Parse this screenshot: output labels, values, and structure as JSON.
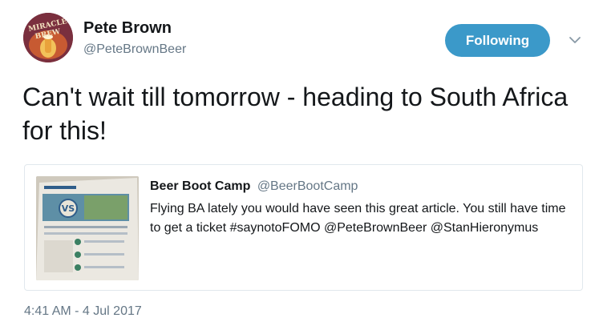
{
  "author": {
    "display_name": "Pete Brown",
    "handle": "@PeteBrownBeer",
    "avatar_icon": "miracle-brew-book-cover-icon",
    "avatar_text": "MIRACLE BREW"
  },
  "follow_button": {
    "label": "Following",
    "color": "#3b99c9"
  },
  "menu": {
    "icon": "chevron-down-icon"
  },
  "tweet": {
    "text": "Can't wait till tomorrow - heading to South Africa for this!"
  },
  "quoted_tweet": {
    "display_name": "Beer Boot Camp",
    "handle": "@BeerBootCamp",
    "text": "Flying BA lately you would have seen this great article. You still have time to get a ticket #saynotoFOMO @PeteBrownBeer @StanHieronymus",
    "image_icon": "magazine-article-photo-icon",
    "image_text": "VS"
  },
  "timestamp": "4:41 AM - 4 Jul 2017"
}
